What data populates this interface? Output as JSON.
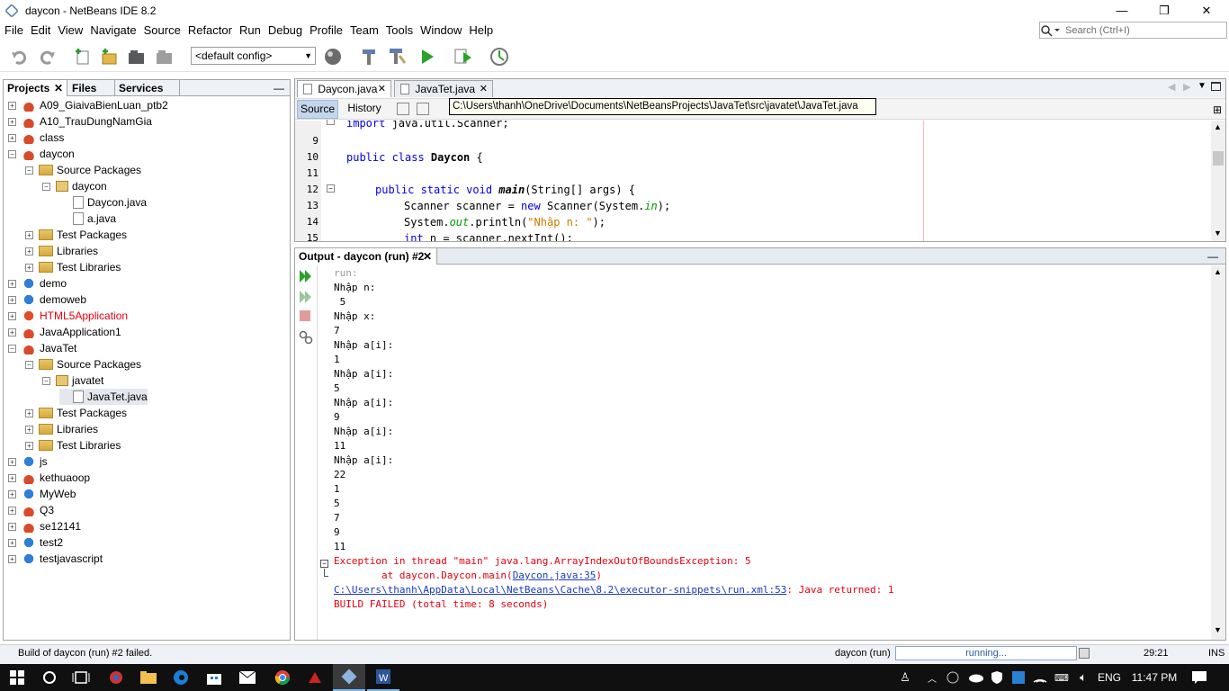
{
  "window": {
    "title": "daycon - NetBeans IDE 8.2",
    "minimize": "—",
    "maximize": "❐",
    "close": "✕"
  },
  "menu": [
    "File",
    "Edit",
    "View",
    "Navigate",
    "Source",
    "Refactor",
    "Run",
    "Debug",
    "Profile",
    "Team",
    "Tools",
    "Window",
    "Help"
  ],
  "search": {
    "placeholder": "Search (Ctrl+I)"
  },
  "toolbar": {
    "config": "<default config>"
  },
  "left_panel": {
    "tabs": [
      "Projects",
      "Files",
      "Services"
    ],
    "minimize": "—",
    "tree": [
      {
        "label": "A09_GiaivaBienLuan_ptb2",
        "icon": "coffee-cup-icon",
        "expander": "+"
      },
      {
        "label": "A10_TrauDungNamGia",
        "icon": "coffee-cup-icon",
        "expander": "+"
      },
      {
        "label": "class",
        "icon": "coffee-cup-icon",
        "expander": "+"
      },
      {
        "label": "daycon",
        "icon": "coffee-cup-icon",
        "expander": "−"
      },
      {
        "label": "Source Packages",
        "icon": "folder-icon",
        "expander": "−"
      },
      {
        "label": "daycon",
        "icon": "package-icon",
        "expander": "−"
      },
      {
        "label": "Daycon.java",
        "icon": "java-file-icon",
        "expander": ""
      },
      {
        "label": "a.java",
        "icon": "java-file-icon",
        "expander": ""
      },
      {
        "label": "Test Packages",
        "icon": "folder-icon",
        "expander": "+"
      },
      {
        "label": "Libraries",
        "icon": "folder-icon",
        "expander": "+"
      },
      {
        "label": "Test Libraries",
        "icon": "folder-icon",
        "expander": "+"
      },
      {
        "label": "demo",
        "icon": "globe-icon",
        "expander": "+"
      },
      {
        "label": "demoweb",
        "icon": "globe-icon",
        "expander": "+"
      },
      {
        "label": "HTML5Application",
        "icon": "html5-icon",
        "expander": "+"
      },
      {
        "label": "JavaApplication1",
        "icon": "coffee-cup-icon",
        "expander": "+"
      },
      {
        "label": "JavaTet",
        "icon": "coffee-cup-icon",
        "expander": "−"
      },
      {
        "label": "Source Packages",
        "icon": "folder-icon",
        "expander": "−"
      },
      {
        "label": "javatet",
        "icon": "package-icon",
        "expander": "−"
      },
      {
        "label": "JavaTet.java",
        "icon": "java-file-icon",
        "expander": ""
      },
      {
        "label": "Test Packages",
        "icon": "folder-icon",
        "expander": "+"
      },
      {
        "label": "Libraries",
        "icon": "folder-icon",
        "expander": "+"
      },
      {
        "label": "Test Libraries",
        "icon": "folder-icon",
        "expander": "+"
      },
      {
        "label": "js",
        "icon": "globe-icon",
        "expander": "+"
      },
      {
        "label": "kethuaoop",
        "icon": "coffee-cup-icon",
        "expander": "+"
      },
      {
        "label": "MyWeb",
        "icon": "globe-icon",
        "expander": "+"
      },
      {
        "label": "Q3",
        "icon": "coffee-cup-icon",
        "expander": "+"
      },
      {
        "label": "se12141",
        "icon": "coffee-cup-icon",
        "expander": "+"
      },
      {
        "label": "test2",
        "icon": "globe-icon",
        "expander": "+"
      },
      {
        "label": "testjavascript",
        "icon": "globe-icon",
        "expander": "+"
      }
    ]
  },
  "editor": {
    "tabs": [
      {
        "label": "Daycon.java",
        "close": "✕"
      },
      {
        "label": "JavaTet.java",
        "close": "✕"
      }
    ],
    "source_btn": "Source",
    "history_btn": "History",
    "tooltip": "C:\\Users\\thanh\\OneDrive\\Documents\\NetBeansProjects\\JavaTet\\src\\javatet\\JavaTet.java",
    "line_numbers": [
      "9",
      "10",
      "11",
      "12",
      "13",
      "14",
      "15"
    ],
    "code": {
      "import_kw": "import",
      "import_rest": " java.util.Scanner;",
      "l10_kw": "public class",
      "l10_name": " Daycon",
      "l10_rest": " {",
      "l12_kw": "public static void",
      "l12_method": "main",
      "l12_rest": "(String[] args) {",
      "l13_a": "Scanner scanner = ",
      "l13_kw": "new",
      "l13_b": " Scanner(System.",
      "l13_fld": "in",
      "l13_c": ");",
      "l14_a": "System.",
      "l14_fld": "out",
      "l14_b": ".println(",
      "l14_str": "\"Nhập n: \"",
      "l14_c": ");",
      "l15_kw": "int",
      "l15_rest": " n = scanner.nextInt();"
    }
  },
  "output": {
    "tab": "Output - daycon (run) #2",
    "close": "✕",
    "minimize": "—",
    "lines": [
      "run:",
      "Nhập n:",
      " 5",
      "Nhập x:",
      "7",
      "Nhập a[i]:",
      "1",
      "Nhập a[i]:",
      "5",
      "Nhập a[i]:",
      "9",
      "Nhập a[i]:",
      "11",
      "Nhập a[i]:",
      "22",
      "1",
      "5",
      "7",
      "9",
      "11"
    ],
    "exception": "Exception in thread \"main\" java.lang.ArrayIndexOutOfBoundsException: 5",
    "at_prefix": "        at daycon.Daycon.main(",
    "at_link": "Daycon.java:35",
    "at_suffix": ")",
    "run_link": "C:\\Users\\thanh\\AppData\\Local\\NetBeans\\Cache\\8.2\\executor-snippets\\run.xml:53",
    "run_suffix": ": Java returned: 1",
    "build_failed": "BUILD FAILED (total time: 8 seconds)"
  },
  "status": {
    "message": "Build of daycon (run) #2 failed.",
    "task": "daycon (run)",
    "progress_text": "running...",
    "position": "29:21",
    "mode": "INS"
  },
  "taskbar": {
    "lang": "ENG",
    "time": "11:47 PM"
  },
  "colors": {
    "error": "#e6000e",
    "keyword": "#0000e6",
    "string": "#ce7b00",
    "link": "#1a3ac0",
    "selection": "#c4d6ec"
  }
}
